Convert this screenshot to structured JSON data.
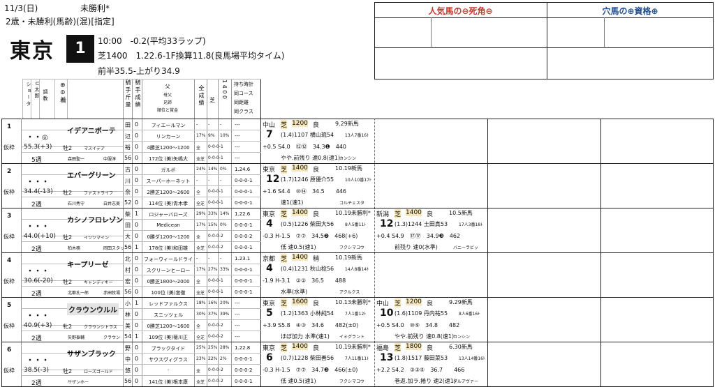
{
  "header": {
    "date": "11/3(日)",
    "race_class": "未勝利*",
    "conditions": "2歳・未勝利(馬齢)(混)[指定]",
    "venue": "東京",
    "race_no": "1",
    "time_line": "10:00　-0.2(平均33ラップ)",
    "course_line": "芝1400　1.22.6-1F換算11.8(良馬場平均タイム)",
    "pace_line": "前半35.5-上がり34.9"
  },
  "notes_table": {
    "left_title": "人気馬の⊖死角⊖",
    "right_title": "穴馬の⊕資格⊕"
  },
  "col_headers": {
    "a1": "シ ョ ー タ",
    "a2": "U 太 郎",
    "a3": "調 教",
    "a4": "⊕ ⊖ 着",
    "b1": "騎 手 斤 量",
    "b2": "騎 手 成 績",
    "c1": "父",
    "c2": "母父",
    "c3": "兄姉",
    "c4": "順位と賞金",
    "d1": "全 成 績",
    "d2": "芝",
    "d3": "1 4 0 0",
    "e1": "持ち時計",
    "e2": "同コース",
    "e3": "同距離",
    "e4": "同クラス"
  },
  "horses": [
    {
      "no": "1",
      "marks": "・・◎",
      "name": "イデアニボーテ",
      "frame": "仮枠",
      "rating": "55.3(+3)",
      "sex_age": "牡2",
      "dam": "マスイデア",
      "weeks": "5週",
      "trainer": "森田聖一",
      "owner": "中服淳",
      "jockey": [
        "田",
        "辺",
        "裕"
      ],
      "jw": "56",
      "jr": [
        "0",
        "0",
        "0",
        "0"
      ],
      "pedigree": [
        [
          "フィエールマン",
          "-",
          "-",
          "-"
        ],
        [
          "リンカーン",
          "17%",
          "9%",
          "10%"
        ],
        [
          "4勝芝1200〜1200",
          "全",
          "0-0-0-1",
          ""
        ],
        [
          "172位 (美)矢嶋大",
          "全芝",
          "0-0-0-1",
          ""
        ]
      ],
      "times": [
        "---",
        "---",
        "---",
        "---"
      ],
      "last1": {
        "line1": [
          "中山",
          "芝",
          "1200",
          "良",
          "9.29新馬"
        ],
        "pos": "7",
        "line2": "(1.4)1107 横山琉54",
        "line2b": "13人7番16ﾄ",
        "line3": "+0.5  S4.0　⑫⑫　34.3❶　440",
        "line4": "やや.前残り 速0.8(速1)",
        "line4b": "カンシン"
      },
      "last2": null
    },
    {
      "no": "2",
      "marks": "・・・",
      "name": "エバーグリーン",
      "frame": "仮枠",
      "rating": "34.4(-13)",
      "sex_age": "牡2",
      "dam": "ファストライフ",
      "weeks": "2週",
      "trainer": "石川秀守",
      "owner": "白井志美",
      "jockey": [
        "古",
        "川",
        "奈"
      ],
      "jw": "52",
      "jr": [
        "0",
        "0",
        "0",
        "0"
      ],
      "pedigree": [
        [
          "ガルボ",
          "24%",
          "14%",
          "0%"
        ],
        [
          "スーパーホーネット",
          "-",
          "-",
          "-"
        ],
        [
          "2勝芝1200〜2600",
          "全",
          "0-0-0-1",
          ""
        ],
        [
          "114位 (美)青木孝",
          "全芝",
          "0-0-0-1",
          ""
        ]
      ],
      "times": [
        "1.24.6",
        "0-0-0-1",
        "0-0-0-1",
        "0-0-0-1"
      ],
      "last1": {
        "line1": [
          "東京",
          "芝",
          "1400",
          "良",
          "10.19新馬"
        ],
        "pos": "12",
        "line2": "(1.7)1246 原優介55",
        "line2b": "10人10番17ﾄ",
        "line3": "+1.6  S4.4　⑩⑭　34.5　　446",
        "line4": "速1(速1)",
        "line4b": "コルチェスタ"
      },
      "last2": null
    },
    {
      "no": "3",
      "marks": "・・・",
      "name": "カシノフロレゾン",
      "frame": "仮枠",
      "rating": "44.0(+10)",
      "sex_age": "牡2",
      "dam": "イツツマイン",
      "weeks": "2週",
      "trainer": "柏木務",
      "owner": "岡田スタッ",
      "jockey": [
        "柴",
        "田",
        "大"
      ],
      "jw": "56",
      "jr": [
        "1",
        "0",
        "0",
        "1"
      ],
      "pedigree": [
        [
          "ロジャーバローズ",
          "29%",
          "33%",
          "14%"
        ],
        [
          "Medicean",
          "17%",
          "15%",
          "0%"
        ],
        [
          "0勝ダ1200〜1200",
          "全",
          "0-0-0-2",
          ""
        ],
        [
          "178位 (美)和田雄",
          "全芝",
          "0-0-0-2",
          ""
        ]
      ],
      "times": [
        "1.22.6",
        "0-0-0-1",
        "0-0-0-2",
        "0-0-0-1"
      ],
      "last1": {
        "line1": [
          "東京",
          "芝",
          "1400",
          "良",
          "10.19未勝利*"
        ],
        "pos": "4",
        "line2": "(0.5)1226 柴田大56",
        "line2b": "8人5番11ﾄ",
        "line3": "-0.3  H-1.5　⑦⑦　34.5❷　468(+6)",
        "line4": "低 速0.5(速1)",
        "line4b": "フクシマコウ"
      },
      "last2": {
        "line1": [
          "新潟",
          "芝",
          "1400",
          "良",
          "10.5新馬"
        ],
        "pos": "12",
        "line2": "(1.3)1244 土田真53",
        "line2b": "17人3番18ﾄ",
        "line3": "+0.4  S4.9　⑰⑰　34.9❸　462",
        "line4": "前残り 速0(水準)",
        "line4b": "バニーラビッ"
      }
    },
    {
      "no": "4",
      "marks": "・・・",
      "name": "キープリーゼ",
      "frame": "仮枠",
      "rating": "30.6(-20)",
      "sex_age": "牡2",
      "dam": "キャンディキー",
      "weeks": "2週",
      "trainer": "北都孔一郎",
      "owner": "赤田牧場",
      "jockey": [
        "北",
        "村",
        "宏"
      ],
      "jw": "56",
      "jr": [
        "0",
        "0",
        "0",
        "0"
      ],
      "pedigree": [
        [
          "フォーウィールドライブ",
          "-",
          "-",
          "-"
        ],
        [
          "スクリーンヒーロー",
          "17%",
          "27%",
          "33%"
        ],
        [
          "0勝芝1800〜2000",
          "全",
          "0-0-0-1",
          ""
        ],
        [
          "100位 (美)宮徹",
          "全芝",
          "0-0-0-1",
          ""
        ]
      ],
      "times": [
        "1.23.1",
        "0-0-0-1",
        "0-0-0-1",
        "0-0-0-1"
      ],
      "last1": {
        "line1": [
          "京都",
          "芝",
          "1400",
          "稍",
          "10.19新馬"
        ],
        "pos": "4",
        "line2": "(0.4)1231 秋山稔56",
        "line2b": "14人8番14ﾄ",
        "line3": "-1.9  H-3.1　②②　36.5　　488",
        "line4": "水準(水準)",
        "line4b": "アクルクス"
      },
      "last2": null
    },
    {
      "no": "5",
      "marks": "・・・",
      "name": "クラウンウルル",
      "frame": "仮枠",
      "rating": "40.9(+3)",
      "sex_age": "牝2",
      "dam": "クラウンシトラス",
      "weeks": "2週",
      "trainer": "矢野泰輔",
      "owner": "クラウン",
      "jockey": [
        "小",
        "林",
        "美"
      ],
      "jw": "54",
      "jr": [
        "1",
        "0",
        "0",
        "1"
      ],
      "pedigree": [
        [
          "レッドファルクス",
          "18%",
          "16%",
          "20%"
        ],
        [
          "スニッツェル",
          "30%",
          "37%",
          "39%"
        ],
        [
          "0勝芝1200〜1600",
          "全",
          "0-0-0-2",
          ""
        ],
        [
          "109位 (美)菊川正",
          "全芝",
          "0-0-0-2",
          ""
        ]
      ],
      "times": [
        "---",
        "---",
        "---",
        "---"
      ],
      "last1": {
        "line1": [
          "東京",
          "芝",
          "1600",
          "良",
          "10.13未勝利*"
        ],
        "pos": "5",
        "line2": "(1.2)1363 小林純54",
        "line2b": "7人1番12ﾄ",
        "line3": "+3.9  S5.8　④③　34.6　　482(±0)",
        "line4": "ほぼ加力 水準(速1)",
        "line4b": "イミグラント"
      },
      "last2": {
        "line1": [
          "中山",
          "芝",
          "1200",
          "良",
          "9.29新馬"
        ],
        "pos": "10",
        "line2": "(1.6)1109 丹内祐55",
        "line2b": "8人6番16ﾄ",
        "line3": "+0.5  S4.0　⑩⑨　34.8　　482",
        "line4": "やや.前残り 速0.8(速1)",
        "line4b": "カンシン"
      }
    },
    {
      "no": "6",
      "marks": "・・・",
      "name": "サザンブラック",
      "frame": "仮枠",
      "rating": "38.5(-3)",
      "sex_age": "牡2",
      "dam": "ローズゴールド",
      "weeks": "2週",
      "trainer": "サザンホー",
      "owner": "",
      "jockey": [
        "野",
        "中",
        "悠"
      ],
      "jw": "56",
      "jr": [
        "0",
        "0",
        "0",
        "0"
      ],
      "pedigree": [
        [
          "ブラックタイド",
          "25%",
          "25%",
          "28%"
        ],
        [
          "サウスヴィグラス",
          "23%",
          "22%",
          "2%"
        ],
        [
          "-",
          "全",
          "0-0-0-2",
          ""
        ],
        [
          "141位 (美)根本康",
          "全芝",
          "0-0-0-2",
          ""
        ]
      ],
      "times": [
        "1.22.8",
        "0-0-0-1",
        "0-0-0-2",
        "0-0-0-1"
      ],
      "last1": {
        "line1": [
          "東京",
          "芝",
          "1400",
          "良",
          "10.19未勝利*"
        ],
        "pos": "6",
        "line2": "(0.7)1228 柴田善56",
        "line2b": "7人11番11ﾄ",
        "line3": "-0.3  H-1.5　⑦⑦　34.7❸　466(±0)",
        "line4": "低 速0.5(速1)",
        "line4b": "フクシマコウ"
      },
      "last2": {
        "line1": [
          "福島",
          "芝",
          "1800",
          "良",
          "6.30新馬"
        ],
        "pos": "13",
        "line2": "(1.8)1517 藤田菜53",
        "line2b": "13人14番16ﾄ",
        "line3": "+2.2  S4.2　③③⑤　36.7　　466",
        "line4": "巻返.加ラ.捲り 速2(速1)",
        "line4b": "ダルアヴァー"
      }
    }
  ]
}
